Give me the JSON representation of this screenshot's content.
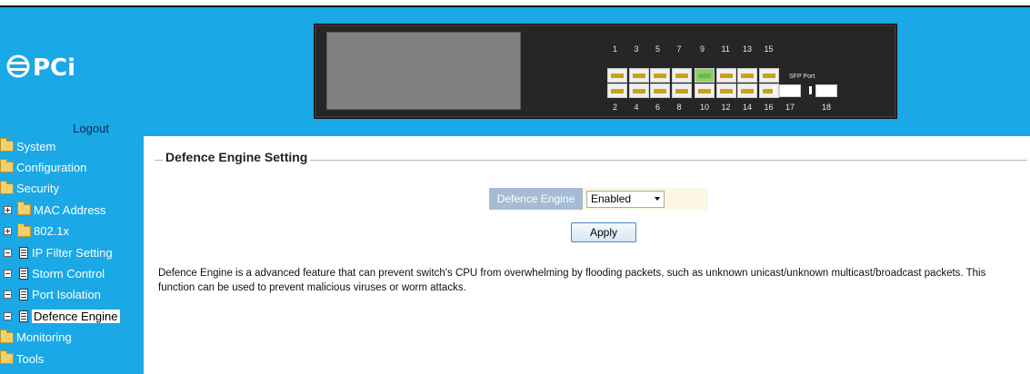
{
  "header": {
    "logo_text": "PCi",
    "logout_label": "Logout"
  },
  "switch_panel": {
    "top_ports": [
      "1",
      "3",
      "5",
      "7",
      "9",
      "11",
      "13",
      "15"
    ],
    "bottom_ports": [
      "2",
      "4",
      "6",
      "8",
      "10",
      "12",
      "14",
      "16"
    ],
    "sfp_label": "SFP Port",
    "sfp_ports": [
      "17",
      "18"
    ],
    "active_port": "9"
  },
  "sidebar": {
    "items": [
      {
        "label": "System",
        "kind": "folder"
      },
      {
        "label": "Configuration",
        "kind": "folder"
      },
      {
        "label": "Security",
        "kind": "folder-open"
      },
      {
        "label": "MAC Address",
        "kind": "sub-folder"
      },
      {
        "label": "802.1x",
        "kind": "sub-folder"
      },
      {
        "label": "IP Filter Setting",
        "kind": "sub-doc"
      },
      {
        "label": "Storm Control",
        "kind": "sub-doc"
      },
      {
        "label": "Port Isolation",
        "kind": "sub-doc"
      },
      {
        "label": "Defence Engine",
        "kind": "sub-doc",
        "active": true
      },
      {
        "label": "Monitoring",
        "kind": "folder"
      },
      {
        "label": "Tools",
        "kind": "folder"
      }
    ]
  },
  "main": {
    "section_title": "Defence Engine Setting",
    "field_label": "Defence Engine",
    "field_value": "Enabled",
    "apply_label": "Apply",
    "description": "Defence Engine is a advanced feature that can prevent switch's CPU from overwhelming by flooding packets, such as unknown unicast/unknown multicast/broadcast packets. This function can be used to prevent malicious viruses or worm attacks."
  },
  "colors": {
    "sidebar_bg": "#1aa8e6",
    "label_bg": "#a6bcd4",
    "field_bg": "#fbf7e3"
  }
}
